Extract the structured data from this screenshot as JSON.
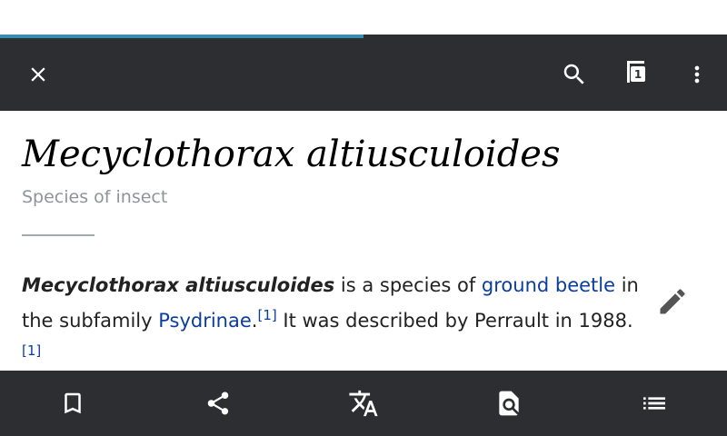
{
  "window": {
    "title": "Mecyclothorax altiusculoides"
  },
  "load_progress": 0.5,
  "colors": {
    "toolbar": "#2c2e31",
    "progress": "#3a8bb0",
    "link": "#0b3d9e",
    "icon": "#ffffff",
    "edit_icon": "#555555"
  },
  "toolbar": {
    "close_icon": "close-icon",
    "search_icon": "search-icon",
    "tabs_icon": "tabs-icon",
    "tabs_count": "1",
    "overflow_icon": "more-vert-icon"
  },
  "article": {
    "title": "Mecyclothorax altiusculoides",
    "description": "Species of insect",
    "lead": {
      "bold_name": "Mecyclothorax altiusculoides",
      "text1": " is a species of ",
      "link1": "ground beetle",
      "text2": " in the subfamily ",
      "link2": "Psydrinae",
      "text3": ".",
      "ref1": "[1]",
      "text4": " It was described by Perrault in 1988.",
      "ref2": "[1]"
    },
    "edit_icon": "pencil-icon"
  },
  "bottom_bar": [
    {
      "icon": "bookmark-icon"
    },
    {
      "icon": "share-icon"
    },
    {
      "icon": "translate-icon"
    },
    {
      "icon": "find-in-page-icon"
    },
    {
      "icon": "contents-icon"
    }
  ]
}
